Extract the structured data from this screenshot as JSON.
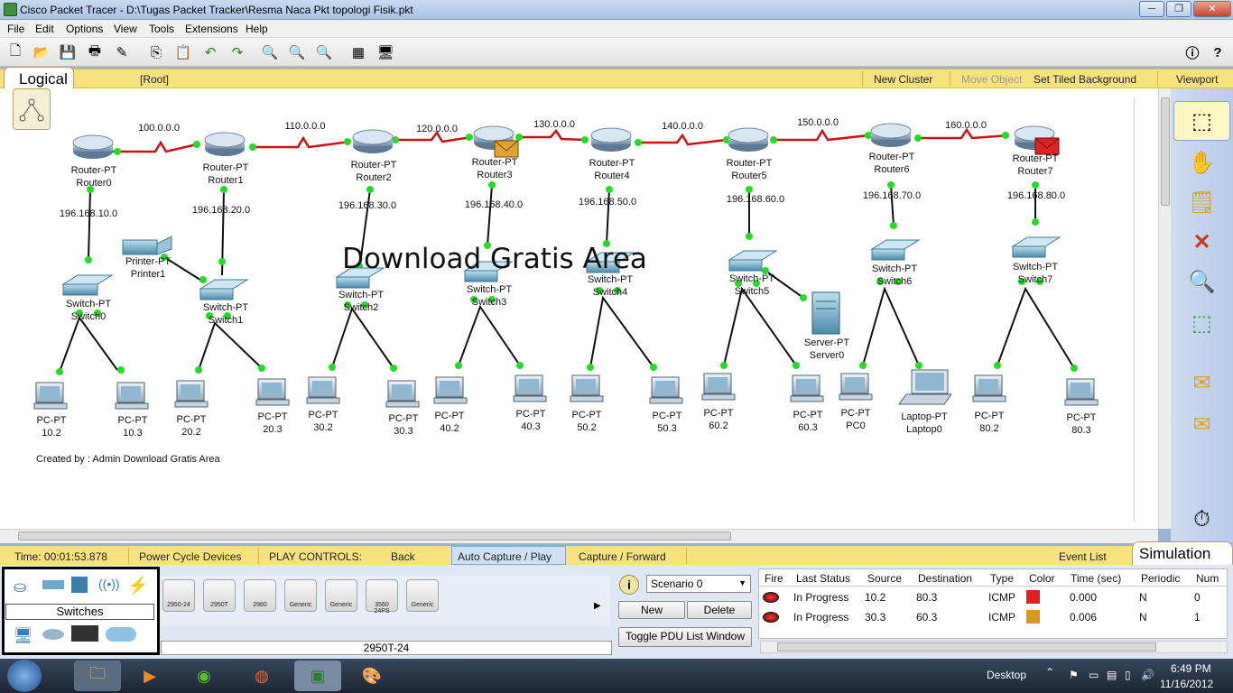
{
  "window": {
    "title": "Cisco Packet Tracer - D:\\Tugas Packet Tracker\\Resma Naca Pkt topologi Fisik.pkt",
    "controls": [
      "─",
      "❐",
      "✕"
    ]
  },
  "menu": [
    "File",
    "Edit",
    "Options",
    "View",
    "Tools",
    "Extensions",
    "Help"
  ],
  "toolbar": {
    "icons": [
      "new-icon",
      "open-icon",
      "save-icon",
      "print-icon",
      "activity-wizard-icon",
      "copy-icon",
      "paste-icon",
      "undo-icon",
      "redo-icon",
      "zoom-in-icon",
      "zoom-reset-icon",
      "zoom-out-icon",
      "palette-icon",
      "custom-device-icon",
      "info-icon",
      "help-icon"
    ]
  },
  "logical_bar": {
    "tab": "Logical",
    "root": "[Root]",
    "new_cluster": "New Cluster",
    "move_object": "Move Object",
    "set_tiled_background": "Set Tiled Background",
    "viewport": "Viewport"
  },
  "topology": {
    "routers": [
      {
        "type": "Router-PT",
        "name": "Router0"
      },
      {
        "type": "Router-PT",
        "name": "Router1"
      },
      {
        "type": "Router-PT",
        "name": "Router2"
      },
      {
        "type": "Router-PT",
        "name": "Router3"
      },
      {
        "type": "Router-PT",
        "name": "Router4"
      },
      {
        "type": "Router-PT",
        "name": "Router5"
      },
      {
        "type": "Router-PT",
        "name": "Router6"
      },
      {
        "type": "Router-PT",
        "name": "Router7"
      }
    ],
    "wan_networks": [
      "100.0.0.0",
      "110.0.0.0",
      "120.0.0.0",
      "130.0.0.0",
      "140.0.0.0",
      "150.0.0.0",
      "160.0.0.0"
    ],
    "lan_networks": [
      "196.168.10.0",
      "196.168.20.0",
      "196.168.30.0",
      "196.168.40.0",
      "196.168.50.0",
      "196.168.60.0",
      "196.168.70.0",
      "196.168.80.0"
    ],
    "switches": [
      {
        "type": "Switch-PT",
        "name": "Switch0"
      },
      {
        "type": "Switch-PT",
        "name": "Switch1"
      },
      {
        "type": "Switch-PT",
        "name": "Switch2"
      },
      {
        "type": "Switch-PT",
        "name": "Switch3"
      },
      {
        "type": "Switch-PT",
        "name": "Switch4"
      },
      {
        "type": "Switch-PT",
        "name": "Switch5"
      },
      {
        "type": "Switch-PT",
        "name": "Switch6"
      },
      {
        "type": "Switch-PT",
        "name": "Switch7"
      }
    ],
    "printer": {
      "type": "Printer-PT",
      "name": "Printer1"
    },
    "server": {
      "type": "Server-PT",
      "name": "Server0"
    },
    "end_devices": [
      {
        "type": "PC-PT",
        "name": "10.2"
      },
      {
        "type": "PC-PT",
        "name": "10.3"
      },
      {
        "type": "PC-PT",
        "name": "20.2"
      },
      {
        "type": "PC-PT",
        "name": "20.3"
      },
      {
        "type": "PC-PT",
        "name": "30.2"
      },
      {
        "type": "PC-PT",
        "name": "30.3"
      },
      {
        "type": "PC-PT",
        "name": "40.2"
      },
      {
        "type": "PC-PT",
        "name": "40.3"
      },
      {
        "type": "PC-PT",
        "name": "50.2"
      },
      {
        "type": "PC-PT",
        "name": "50.3"
      },
      {
        "type": "PC-PT",
        "name": "60.2"
      },
      {
        "type": "PC-PT",
        "name": "60.3"
      },
      {
        "type": "PC-PT",
        "name": "PC0"
      },
      {
        "type": "Laptop-PT",
        "name": "Laptop0"
      },
      {
        "type": "PC-PT",
        "name": "80.2"
      },
      {
        "type": "PC-PT",
        "name": "80.3"
      }
    ],
    "watermark": "Download Gratis Area",
    "credit": "Created by : Admin Download Gratis Area"
  },
  "status_bar": {
    "time": "Time: 00:01:53.878",
    "power_cycle": "Power Cycle Devices",
    "play_controls": "PLAY CONTROLS:",
    "back": "Back",
    "auto_capture": "Auto Capture / Play",
    "capture_forward": "Capture / Forward",
    "event_list": "Event List",
    "mode": "Simulation"
  },
  "device_panel": {
    "category": "Switches",
    "models": [
      "2950-24",
      "2950T",
      "2960",
      "Generic",
      "Generic",
      "3560 24PS",
      "Generic"
    ],
    "selected_model": "2950T-24"
  },
  "scenario": {
    "info_icon": "i",
    "selected": "Scenario 0",
    "new": "New",
    "delete": "Delete",
    "toggle": "Toggle PDU List Window"
  },
  "pdu_list": {
    "headers": [
      "Fire",
      "Last Status",
      "Source",
      "Destination",
      "Type",
      "Color",
      "Time (sec)",
      "Periodic",
      "Num"
    ],
    "rows": [
      {
        "status": "In Progress",
        "source": "10.2",
        "destination": "80.3",
        "type": "ICMP",
        "color": "#dd2222",
        "time": "0.000",
        "periodic": "N",
        "num": "0"
      },
      {
        "status": "In Progress",
        "source": "30.3",
        "destination": "60.3",
        "type": "ICMP",
        "color": "#d89a1e",
        "time": "0.006",
        "periodic": "N",
        "num": "1"
      }
    ]
  },
  "taskbar": {
    "desktop": "Desktop",
    "time": "6:49 PM",
    "date": "11/16/2012"
  }
}
